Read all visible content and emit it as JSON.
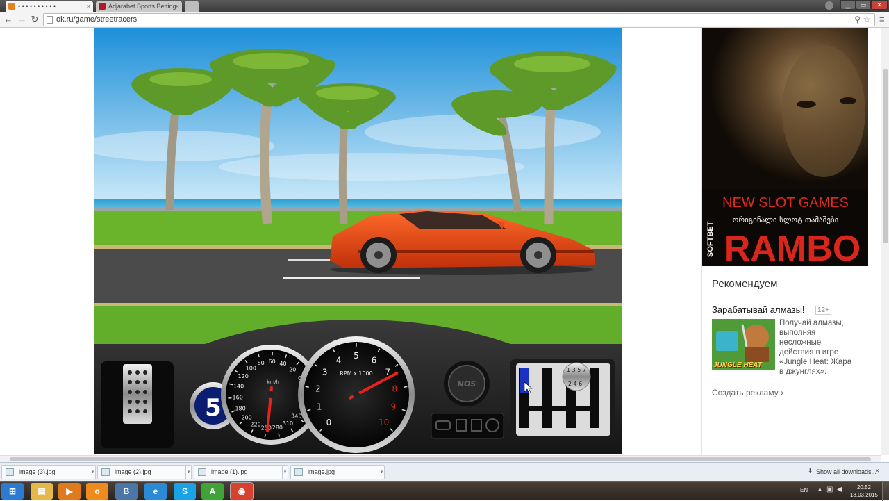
{
  "browser": {
    "tabs": [
      {
        "label": "• • • • • • • • • •",
        "favicon_color": "#e8821e"
      },
      {
        "label": "Adjarabet Sports Betting",
        "favicon_color": "#b0182b"
      }
    ],
    "tab_close": "×",
    "url": "ok.ru/game/streetracers",
    "window_controls": [
      "▁",
      "▭",
      "✕"
    ]
  },
  "game": {
    "nos_label": "NOS",
    "gear_display": "5",
    "tachometer": {
      "unit": "RPM x 1000",
      "ticks": [
        "0",
        "1",
        "2",
        "3",
        "4",
        "5",
        "6",
        "7",
        "8",
        "9",
        "10"
      ],
      "redline_from": 8,
      "needle_value": 7.3
    },
    "speedometer": {
      "unit": "km/h",
      "ticks": [
        "0",
        "20",
        "40",
        "60",
        "80",
        "100",
        "120",
        "140",
        "160",
        "180",
        "200",
        "220",
        "250",
        "280",
        "310",
        "340"
      ],
      "needle_value": 275
    },
    "shifter": {
      "top_labels": "1 3 5 7",
      "bottom_labels": "2 4 6",
      "current_gear": 1
    }
  },
  "ad": {
    "headline": "NEW SLOT GAMES",
    "subline": "ორიგინალი სლოტ თამაშები",
    "brand": "SOFTBET",
    "title": "RAMBO"
  },
  "sidebar": {
    "recommend_title": "Рекомендуем",
    "promo_title": "Зарабатывай алмазы!",
    "age_badge": "12+",
    "promo_image_label": "JUNGLE HEAT",
    "promo_text": "Получай алмазы, выполняя несложные действия в игре «Jungle Heat: Жара в джунглях».",
    "create_ad": "Создать рекламу ›"
  },
  "downloads": {
    "items": [
      "image (3).jpg",
      "image (2).jpg",
      "image (1).jpg",
      "image.jpg"
    ],
    "show_all": "Show all downloads...",
    "close": "×"
  },
  "taskbar": {
    "apps": [
      {
        "name": "start",
        "glyph": "⊞",
        "color": "#2c7bd1"
      },
      {
        "name": "explorer",
        "glyph": "▤",
        "color": "#e6b84a"
      },
      {
        "name": "media-player",
        "glyph": "▶",
        "color": "#e07a1f"
      },
      {
        "name": "odnoklassniki",
        "glyph": "о",
        "color": "#ef8a1c"
      },
      {
        "name": "vkontakte",
        "glyph": "В",
        "color": "#4a76a8"
      },
      {
        "name": "internet-explorer",
        "glyph": "e",
        "color": "#2a8ad6"
      },
      {
        "name": "skype",
        "glyph": "S",
        "color": "#19a3e6"
      },
      {
        "name": "game-app",
        "glyph": "A",
        "color": "#3fa33a"
      },
      {
        "name": "chrome",
        "glyph": "◉",
        "color": "#d9412f"
      }
    ],
    "language": "EN",
    "time": "20:52",
    "date": "18.03.2015"
  }
}
